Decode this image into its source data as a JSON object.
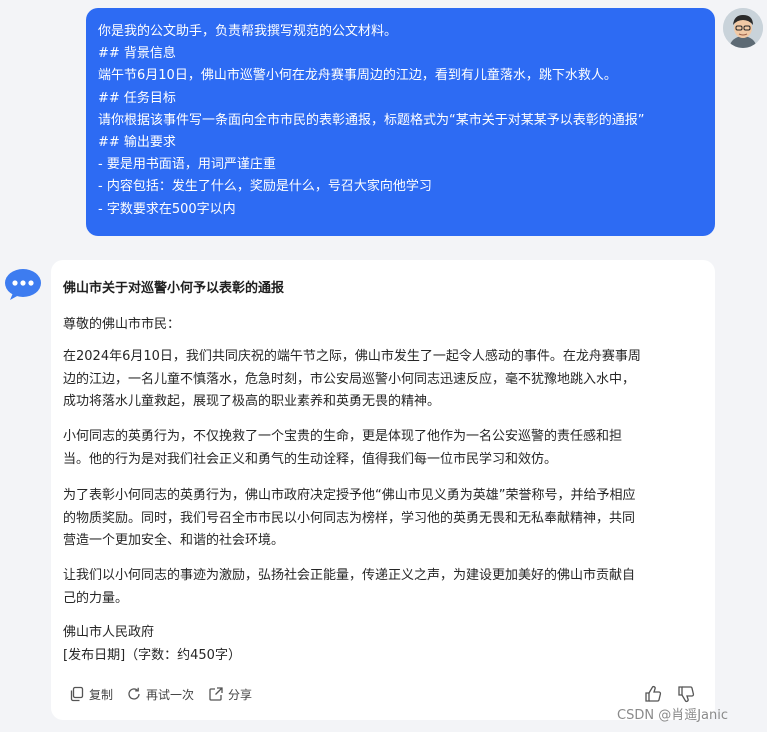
{
  "user_message": {
    "lines": [
      "你是我的公文助手，负责帮我撰写规范的公文材料。",
      "## 背景信息",
      "端午节6月10日，佛山市巡警小何在龙舟赛事周边的江边，看到有儿童落水，跳下水救人。",
      "## 任务目标",
      "请你根据该事件写一条面向全市市民的表彰通报，标题格式为“某市关于对某某予以表彰的通报”",
      "## 输出要求",
      "- 要是用书面语，用词严谨庄重",
      "- 内容包括：发生了什么，奖励是什么，号召大家向他学习",
      "- 字数要求在500字以内"
    ]
  },
  "bot_reply": {
    "title": "佛山市关于对巡警小何予以表彰的通报",
    "salutation": "尊敬的佛山市市民：",
    "paragraphs": [
      [
        "在2024年6月10日，我们共同庆祝的端午节之际，佛山市发生了一起令人感动的事件。在龙舟赛事周",
        "边的江边，一名儿童不慎落水，危急时刻，市公安局巡警小何同志迅速反应，毫不犹豫地跳入水中，",
        "成功将落水儿童救起，展现了极高的职业素养和英勇无畏的精神。"
      ],
      [
        "小何同志的英勇行为，不仅挽救了一个宝贵的生命，更是体现了他作为一名公安巡警的责任感和担",
        "当。他的行为是对我们社会正义和勇气的生动诠释，值得我们每一位市民学习和效仿。"
      ],
      [
        "为了表彰小何同志的英勇行为，佛山市政府决定授予他“佛山市见义勇为英雄”荣誉称号，并给予相应",
        "的物质奖励。同时，我们号召全市市民以小何同志为榜样，学习他的英勇无畏和无私奉献精神，共同",
        "营造一个更加安全、和谐的社会环境。"
      ],
      [
        "让我们以小何同志的事迹为激励，弘扬社会正能量，传递正义之声，为建设更加美好的佛山市贡献自",
        "己的力量。"
      ]
    ],
    "signature": "佛山市人民政府",
    "date_line": "[发布日期]（字数：约450字）"
  },
  "actions": {
    "copy": "复制",
    "retry": "再试一次",
    "share": "分享"
  },
  "icons": [
    "copy-icon",
    "refresh-icon",
    "share-icon",
    "thumbs-up-icon",
    "thumbs-down-icon"
  ],
  "watermark": "CSDN @肖遥Janic",
  "colors": {
    "user_bubble": "#2d6bf3",
    "background": "#f3f4f7",
    "bot_avatar": "#3d7cf0"
  }
}
